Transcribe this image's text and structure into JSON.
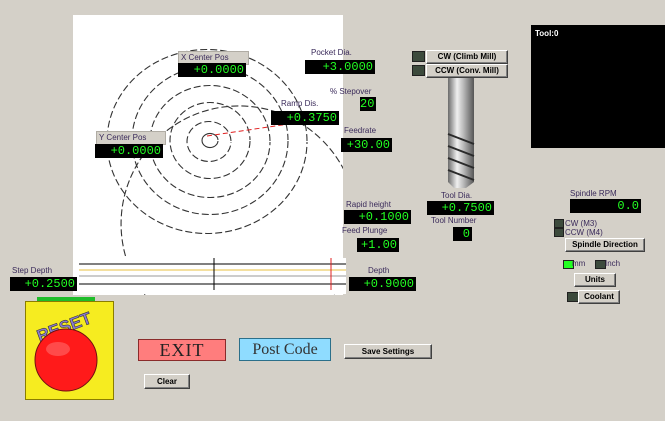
{
  "tool_panel": {
    "title": "Tool:0"
  },
  "labels": {
    "x_center": "X Center Pos",
    "y_center": "Y Center Pos",
    "pocket_dia": "Pocket Dia.",
    "stepover": "% Stepover",
    "ramp_dis": "Ramp Dis.",
    "feedrate": "Feedrate",
    "tool_dia": "Tool Dia.",
    "tool_number": "Tool Number",
    "rapid_height": "Rapid height",
    "feed_plunge": "Feed Plunge",
    "depth": "Depth",
    "step_depth": "Step Depth",
    "spindle_rpm": "Spindle RPM"
  },
  "values": {
    "x_center": "+0.0000",
    "y_center": "+0.0000",
    "pocket_dia": "+3.0000",
    "stepover": "20",
    "ramp_dis": "+0.3750",
    "feedrate": "+30.00",
    "tool_dia": "+0.7500",
    "tool_number": "0",
    "rapid_height": "+0.1000",
    "feed_plunge": "+1.00",
    "depth": "+0.9000",
    "step_depth": "+0.2500",
    "spindle_rpm": "0.0"
  },
  "buttons": {
    "cw": "CW (Climb Mill)",
    "ccw": "CCW (Conv. Mill)",
    "spindle_direction": "Spindle Direction",
    "units": "Units",
    "coolant": "Coolant",
    "exit": "EXIT",
    "post_code": "Post Code",
    "save_settings": "Save Settings",
    "clear": "Clear"
  },
  "spindle": {
    "cw_label": "CW (M3)",
    "ccw_label": "CCW (M4)"
  },
  "units": {
    "mm": "mm",
    "inch": "Inch",
    "selected": "mm"
  },
  "reset": {
    "label": "RESET"
  },
  "colors": {
    "dro_text": "#22ff22",
    "exit": "#ff7d7d",
    "post_code": "#8fdcff",
    "reset_bg": "#f6ec20",
    "reset_button": "#ff1a1a"
  }
}
